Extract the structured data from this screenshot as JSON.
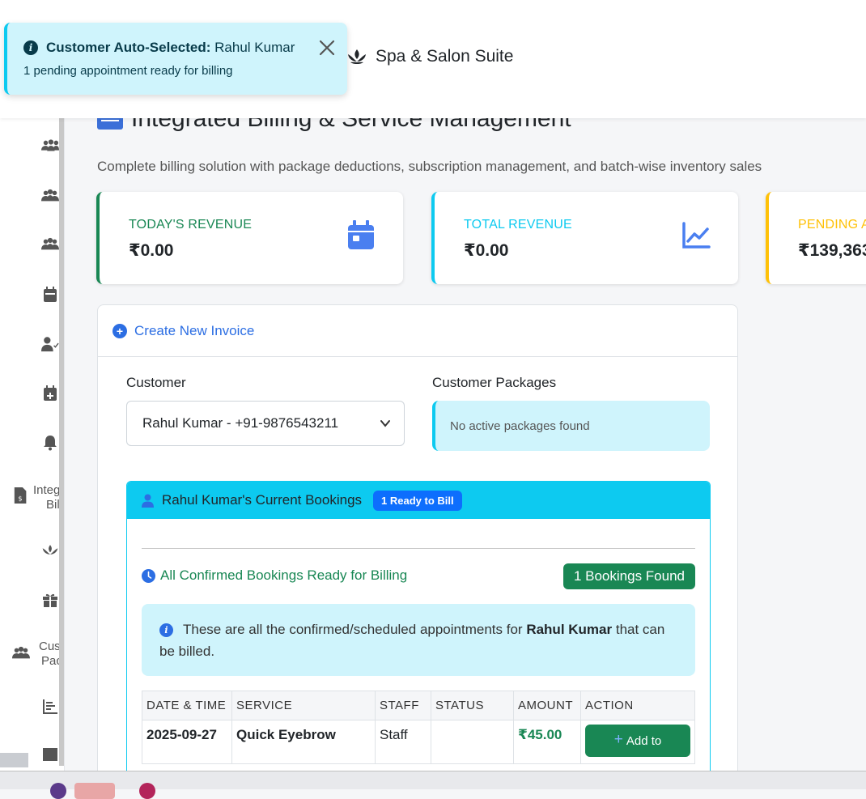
{
  "app": {
    "brand": "Spa & Salon Suite"
  },
  "toast": {
    "title_bold": "Customer Auto-Selected:",
    "customer": "Rahul Kumar",
    "message": "1 pending appointment ready for billing"
  },
  "page": {
    "title": "Integrated Billing & Service Management",
    "subtitle": "Complete billing solution with package deductions, subscription management, and batch-wise inventory sales"
  },
  "sidebar": {
    "items": [
      {
        "icon": "users-gear-icon"
      },
      {
        "icon": "users-icon"
      },
      {
        "icon": "users-group-icon"
      },
      {
        "icon": "calendar-icon"
      },
      {
        "icon": "user-check-icon"
      },
      {
        "icon": "calendar-plus-icon"
      },
      {
        "icon": "bell-icon"
      },
      {
        "icon": "file-invoice-dollar-icon",
        "label1": "Integ",
        "label2": "Bil"
      },
      {
        "icon": "spa-lotus-icon"
      },
      {
        "icon": "gift-icon"
      },
      {
        "icon": "users-group-icon",
        "label1": "Cus",
        "label2": "Pac"
      },
      {
        "icon": "chart-bar-icon"
      }
    ]
  },
  "stats": [
    {
      "label": "TODAY'S REVENUE",
      "value": "₹0.00",
      "color": "#198754",
      "label_color": "#198754",
      "icon": "calendar-icon"
    },
    {
      "label": "TOTAL REVENUE",
      "value": "₹0.00",
      "color": "#0dcaf0",
      "label_color": "#0dcaf0",
      "icon": "chart-line-icon"
    },
    {
      "label": "PENDING A",
      "value": "₹139,363",
      "color": "#ffc107",
      "label_color": "#ffc107"
    }
  ],
  "invoice": {
    "header": "Create New Invoice",
    "customer_label": "Customer",
    "customer_value": "Rahul Kumar - +91-9876543211",
    "packages_label": "Customer Packages",
    "packages_empty": "No active packages found"
  },
  "bookings": {
    "title": "Rahul Kumar's Current Bookings",
    "badge": "1 Ready to Bill",
    "confirmed_label": "All Confirmed Bookings Ready for Billing",
    "found": "1 Bookings Found",
    "info_prefix": "These are all the confirmed/scheduled appointments for",
    "info_name": "Rahul Kumar",
    "info_suffix": "that can be billed.",
    "columns": [
      "DATE & TIME",
      "SERVICE",
      "STAFF",
      "STATUS",
      "AMOUNT",
      "ACTION"
    ],
    "rows": [
      {
        "date": "2025-09-27",
        "service": "Quick Eyebrow",
        "staff": "Staff",
        "status": "",
        "amount": "₹45.00",
        "action": "Add to"
      }
    ]
  },
  "colors": {
    "primary": "#2c6ee3",
    "info": "#0dcaf0",
    "success": "#198754",
    "warning": "#ffc107"
  }
}
